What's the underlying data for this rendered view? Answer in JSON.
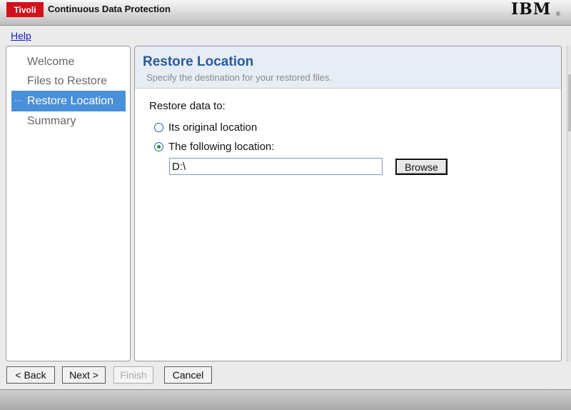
{
  "banner": {
    "brand": "Tivoli",
    "product": "Continuous Data Protection",
    "vendor_logo": "IBM",
    "vendor_mark": "®"
  },
  "menu": {
    "help": "Help"
  },
  "nav": {
    "items": [
      {
        "label": "Welcome",
        "active": false
      },
      {
        "label": "Files to Restore",
        "active": false
      },
      {
        "label": "Restore Location",
        "active": true
      },
      {
        "label": "Summary",
        "active": false
      }
    ],
    "active_marker": "···"
  },
  "main": {
    "title": "Restore Location",
    "subtitle": "Specify the destination for your restored files.",
    "restore_label": "Restore data to:",
    "options": [
      {
        "label": "Its original location",
        "checked": false
      },
      {
        "label": "The following location:",
        "checked": true
      }
    ],
    "path_value": "D:\\",
    "browse_label": "Browse"
  },
  "footer": {
    "back": "< Back",
    "next": "Next >",
    "finish": "Finish",
    "cancel": "Cancel"
  },
  "colors": {
    "brand_red": "#d1111b",
    "nav_active": "#4a90d9",
    "title_blue": "#2a5a9a",
    "header_bg": "#e6edf4"
  }
}
